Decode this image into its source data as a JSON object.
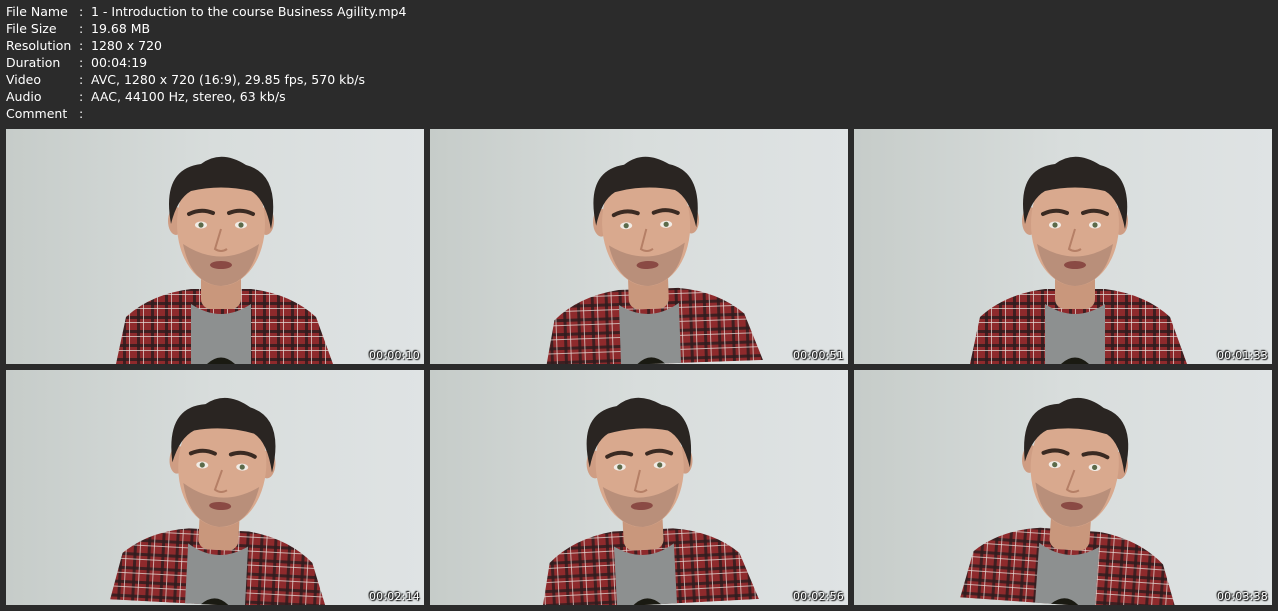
{
  "info": [
    {
      "key": "File Name",
      "sep": ":",
      "value": "1 - Introduction to the course Business Agility.mp4"
    },
    {
      "key": "File Size",
      "sep": ":",
      "value": "19.68 MB"
    },
    {
      "key": "Resolution",
      "sep": ":",
      "value": "1280 x 720"
    },
    {
      "key": "Duration",
      "sep": ":",
      "value": "00:04:19"
    },
    {
      "key": "Video",
      "sep": ":",
      "value": "AVC, 1280 x 720 (16:9), 29.85 fps, 570 kb/s"
    },
    {
      "key": "Audio",
      "sep": ":",
      "value": "AAC, 44100 Hz, stereo, 63 kb/s"
    },
    {
      "key": "Comment",
      "sep": ":",
      "value": ""
    }
  ],
  "thumbnails": [
    {
      "timestamp": "00:00:10"
    },
    {
      "timestamp": "00:00:51"
    },
    {
      "timestamp": "00:01:33"
    },
    {
      "timestamp": "00:02:14"
    },
    {
      "timestamp": "00:02:56"
    },
    {
      "timestamp": "00:03:38"
    }
  ],
  "colors": {
    "background": "#2b2b2b",
    "text": "#ffffff",
    "wall": "#d8dddc",
    "hair": "#2a2522",
    "skin": "#d9a98e",
    "shirt_red": "#8e2a2c",
    "tshirt": "#8d9090"
  }
}
